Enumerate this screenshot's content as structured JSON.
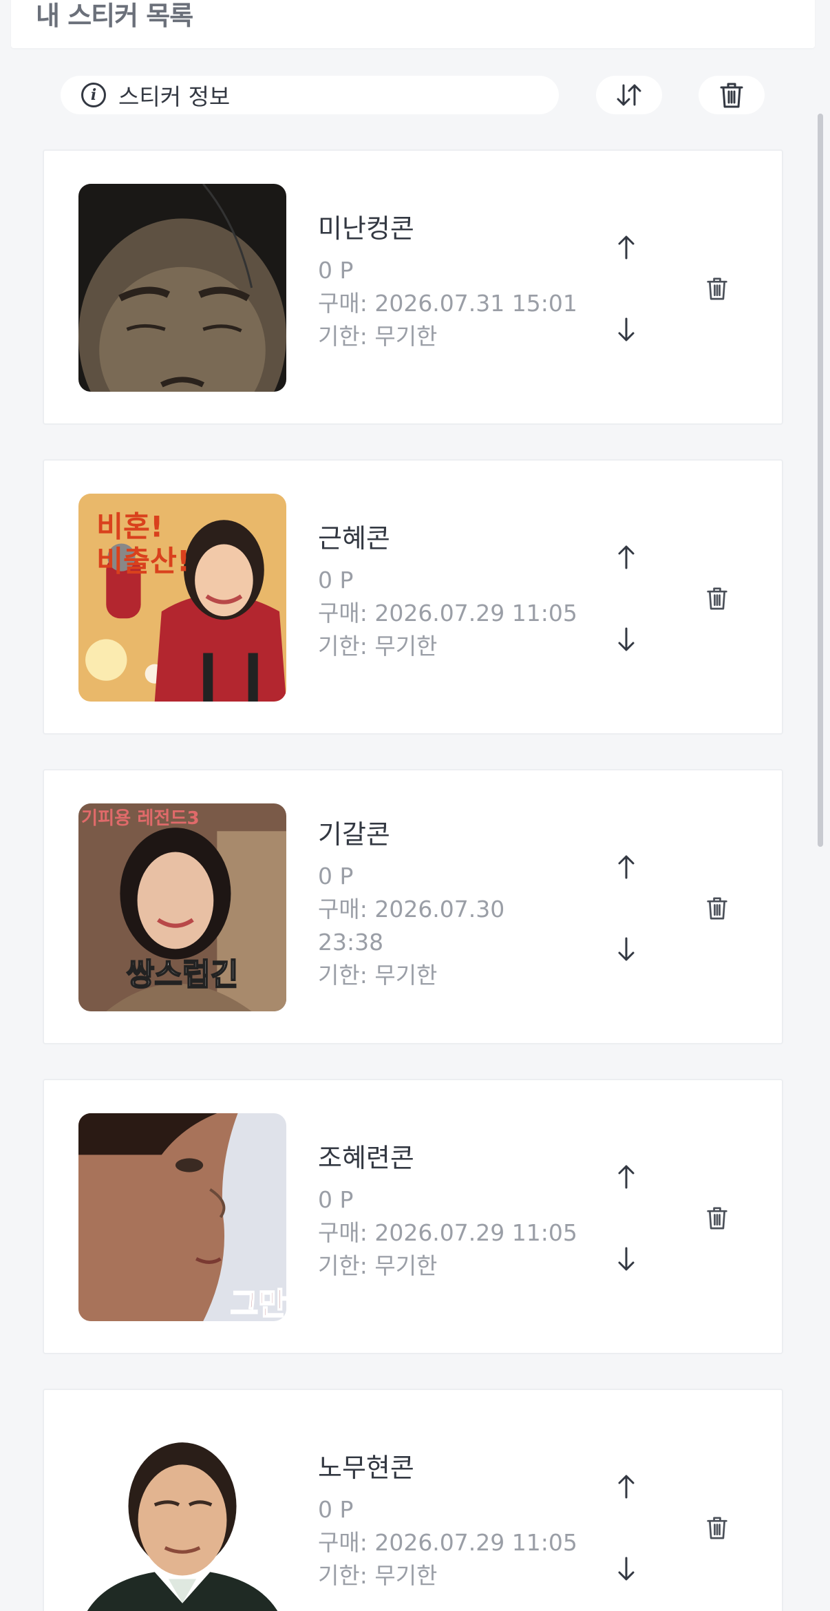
{
  "header": {
    "title": "내 스티커 목록"
  },
  "toolbar": {
    "info_label": "스티커 정보",
    "info_icon": "info-circle-icon",
    "sort_icon": "sort-arrows-icon",
    "delete_all_icon": "trash-icon"
  },
  "stickers": [
    {
      "name": "미난컹콘",
      "price": "0 P",
      "purchase": "구매: 2026.07.31 15:01",
      "expiry": "기한: 무기한",
      "thumb_text": ""
    },
    {
      "name": "근혜콘",
      "price": "0 P",
      "purchase": "구매: 2026.07.29 11:05",
      "expiry": "기한: 무기한",
      "thumb_text": "비혼!\n비출산!"
    },
    {
      "name": "기갈콘",
      "price": "0 P",
      "purchase": "구매: 2026.07.30 23:38",
      "expiry": "기한: 무기한",
      "thumb_text": "쌍스럽긴",
      "thumb_caption": "기피용 레전드3"
    },
    {
      "name": "조혜련콘",
      "price": "0 P",
      "purchase": "구매: 2026.07.29 11:05",
      "expiry": "기한: 무기한",
      "thumb_text": "그만"
    },
    {
      "name": "노무현콘",
      "price": "0 P",
      "purchase": "구매: 2026.07.29 11:05",
      "expiry": "기한: 무기한",
      "thumb_text": ""
    }
  ],
  "colors": {
    "background": "#f5f6f8",
    "card": "#ffffff",
    "text_primary": "#333842",
    "text_secondary": "#9a9ea6"
  }
}
